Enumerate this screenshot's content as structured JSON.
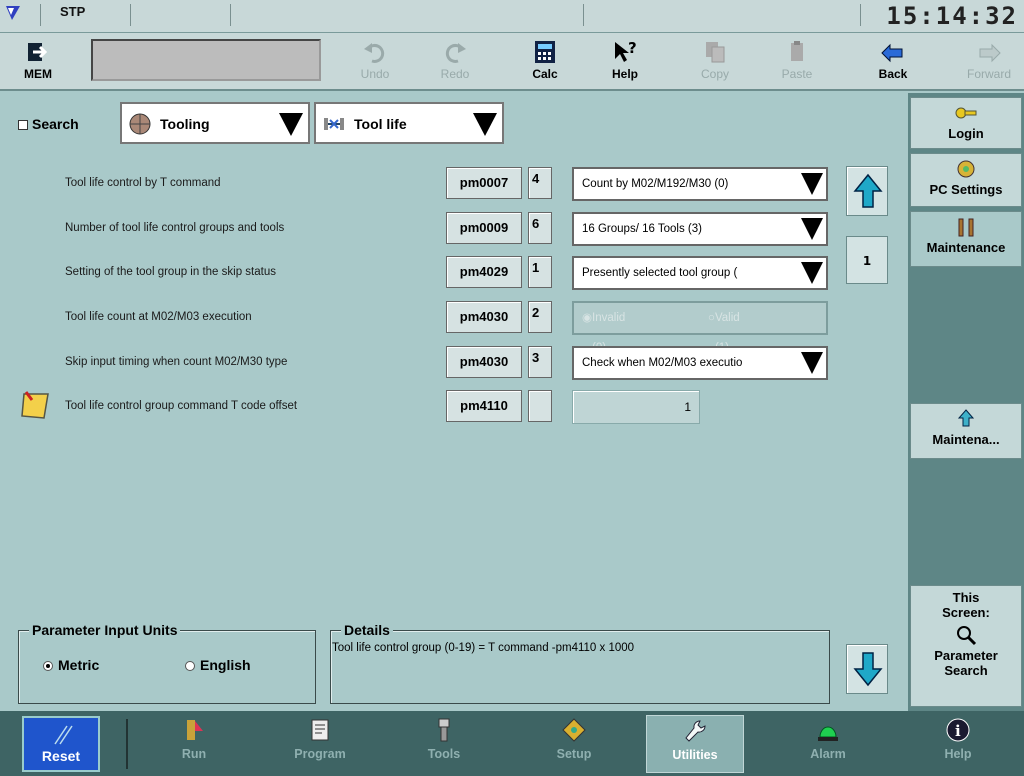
{
  "status": {
    "mode": "STP",
    "clock": "15:14:32"
  },
  "toolbar": {
    "mem_label": "MEM",
    "undo": "Undo",
    "redo": "Redo",
    "calc": "Calc",
    "help": "Help",
    "copy": "Copy",
    "paste": "Paste",
    "back": "Back",
    "forward": "Forward"
  },
  "selector": {
    "search_label": "Search",
    "category": "Tooling",
    "subcategory": "Tool life"
  },
  "params": [
    {
      "desc": "Tool life control by T command",
      "id": "pm0007",
      "bit": "4",
      "kind": "dropdown",
      "value": "Count by M02/M192/M30 (0)"
    },
    {
      "desc": "Number of tool life control groups and tools",
      "id": "pm0009",
      "bit": "6",
      "kind": "dropdown",
      "value": "16 Groups/ 16 Tools (3)"
    },
    {
      "desc": "Setting of the tool group in the skip status",
      "id": "pm4029",
      "bit": "1",
      "kind": "dropdown",
      "value": "Presently selected tool group ("
    },
    {
      "desc": "Tool life count at M02/M03 execution",
      "id": "pm4030",
      "bit": "2",
      "kind": "radios",
      "value": "",
      "opt1": "Invalid (0)",
      "opt2": "Valid (1)"
    },
    {
      "desc": "Skip input timing when count M02/M30 type",
      "id": "pm4030",
      "bit": "3",
      "kind": "dropdown",
      "value": "Check when M02/M03 executio"
    },
    {
      "desc": "Tool life control group command T code offset",
      "id": "pm4110",
      "bit": "",
      "kind": "number",
      "value": "1"
    }
  ],
  "page_number": "1",
  "units": {
    "title": "Parameter Input Units",
    "metric": "Metric",
    "english": "English",
    "selected": "Metric"
  },
  "details": {
    "title": "Details",
    "text": "Tool life control group (0-19) = T command -pm4110 x 1000"
  },
  "side": {
    "login": "Login",
    "pc_settings": "PC Settings",
    "maintenance": "Maintenance",
    "maintena": "Maintena...",
    "this_screen_1": "This",
    "this_screen_2": "Screen:",
    "param_search_1": "Parameter",
    "param_search_2": "Search"
  },
  "nav": {
    "reset": "Reset",
    "run": "Run",
    "program": "Program",
    "tools": "Tools",
    "setup": "Setup",
    "utilities": "Utilities",
    "alarm": "Alarm",
    "help": "Help",
    "active": "Utilities"
  },
  "colors": {
    "background": "#a9c9c9",
    "nav_bar": "#3e6464",
    "reset_blue": "#1f55cc",
    "scroll_arrow": "#1fa8c8"
  }
}
